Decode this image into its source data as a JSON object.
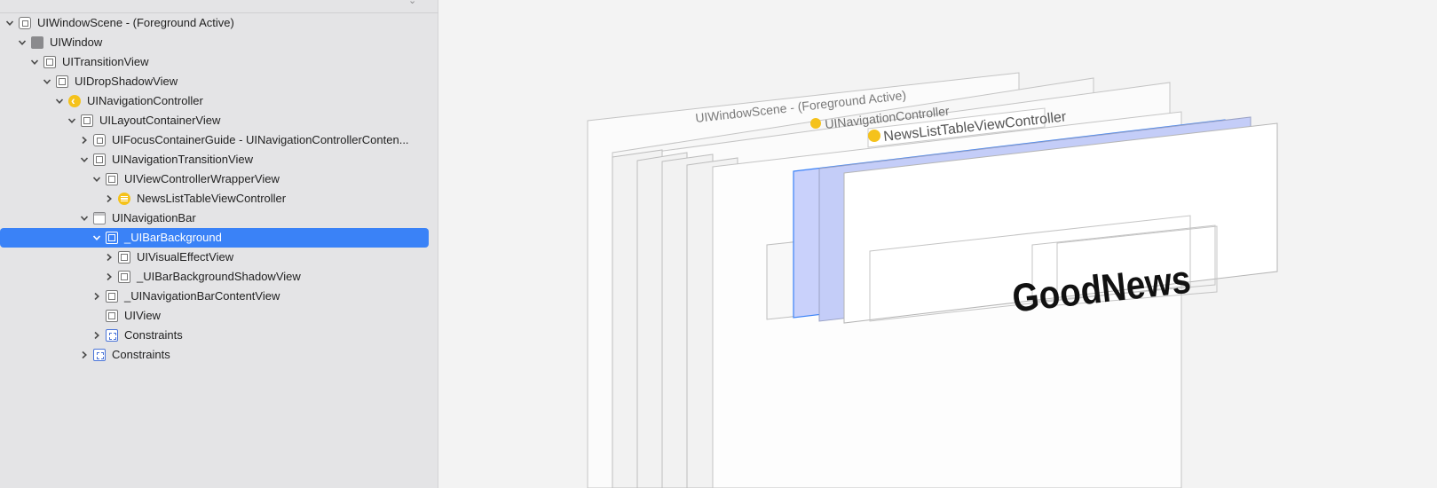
{
  "tree": [
    {
      "label": "UIWindowScene - (Foreground Active)",
      "level": 0,
      "disclosure": "open",
      "icon": "scene-icon",
      "selected": false
    },
    {
      "label": "UIWindow",
      "level": 1,
      "disclosure": "open",
      "icon": "solid-square-icon",
      "selected": false
    },
    {
      "label": "UITransitionView",
      "level": 2,
      "disclosure": "open",
      "icon": "view-icon",
      "selected": false
    },
    {
      "label": "UIDropShadowView",
      "level": 3,
      "disclosure": "open",
      "icon": "view-icon",
      "selected": false
    },
    {
      "label": "UINavigationController",
      "level": 4,
      "disclosure": "open",
      "icon": "nav-controller-icon",
      "selected": false
    },
    {
      "label": "UILayoutContainerView",
      "level": 5,
      "disclosure": "open",
      "icon": "view-icon",
      "selected": false
    },
    {
      "label": "UIFocusContainerGuide - UINavigationControllerConten...",
      "level": 6,
      "disclosure": "closed",
      "icon": "focus-guide-icon",
      "selected": false
    },
    {
      "label": "UINavigationTransitionView",
      "level": 6,
      "disclosure": "open",
      "icon": "view-icon",
      "selected": false
    },
    {
      "label": "UIViewControllerWrapperView",
      "level": 7,
      "disclosure": "open",
      "icon": "view-icon",
      "selected": false
    },
    {
      "label": "NewsListTableViewController",
      "level": 8,
      "disclosure": "closed",
      "icon": "table-controller-icon",
      "selected": false
    },
    {
      "label": "UINavigationBar",
      "level": 6,
      "disclosure": "open",
      "icon": "nav-bar-icon",
      "selected": false
    },
    {
      "label": "_UIBarBackground",
      "level": 7,
      "disclosure": "open",
      "icon": "view-icon",
      "selected": true
    },
    {
      "label": "UIVisualEffectView",
      "level": 8,
      "disclosure": "closed",
      "icon": "view-icon",
      "selected": false
    },
    {
      "label": "_UIBarBackgroundShadowView",
      "level": 8,
      "disclosure": "closed",
      "icon": "view-icon",
      "selected": false
    },
    {
      "label": "_UINavigationBarContentView",
      "level": 7,
      "disclosure": "closed",
      "icon": "view-icon",
      "selected": false
    },
    {
      "label": "UIView",
      "level": 7,
      "disclosure": "none",
      "icon": "view-icon",
      "selected": false
    },
    {
      "label": "Constraints",
      "level": 7,
      "disclosure": "closed",
      "icon": "constraints-icon",
      "selected": false
    },
    {
      "label": "Constraints",
      "level": 6,
      "disclosure": "closed",
      "icon": "constraints-icon",
      "selected": false
    }
  ],
  "canvas": {
    "scene_label": "UIWindowScene - (Foreground Active)",
    "nav_controller_label": "UINavigationController",
    "table_controller_label": "NewsListTableViewController",
    "title_text": "GoodNews"
  },
  "colors": {
    "selection": "#3a82f7",
    "highlight_fill": "#c9d1fb",
    "highlight_stroke": "#3a82f7",
    "icon_yellow": "#f5c21b"
  }
}
